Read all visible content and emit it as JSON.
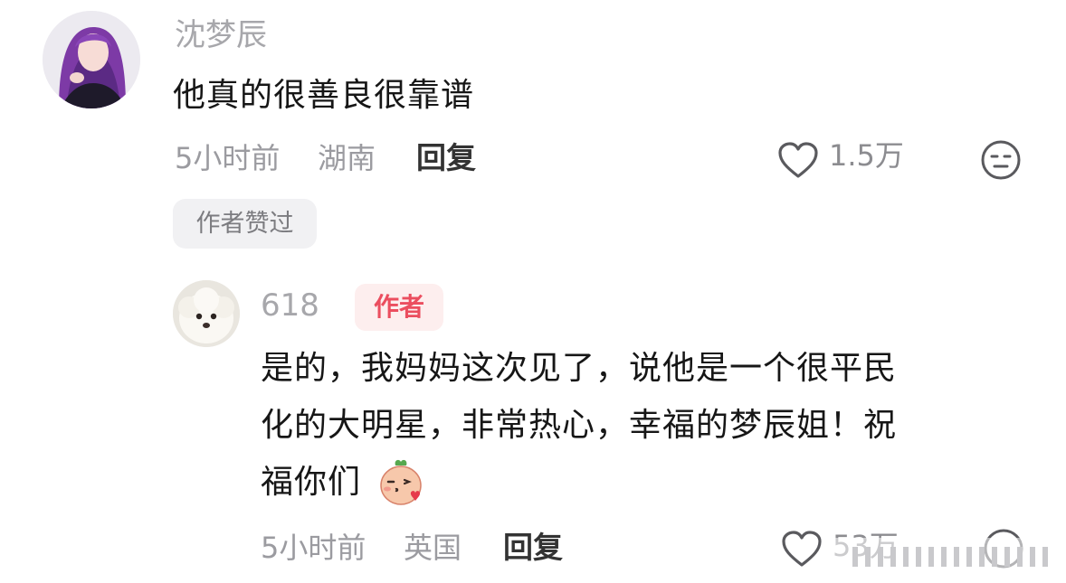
{
  "comment": {
    "username": "沈梦辰",
    "text": "他真的很善良很靠谱",
    "time": "5小时前",
    "location": "湖南",
    "reply_label": "回复",
    "like_count": "1.5万",
    "author_liked_badge": "作者赞过"
  },
  "reply": {
    "username": "618",
    "author_badge": "作者",
    "text_lines": [
      "是的，我妈妈这次见了，说他是一个很平民",
      "化的大明星，非常热心，幸福的梦辰姐！祝",
      "福你们"
    ],
    "time": "5小时前",
    "location": "英国",
    "reply_label": "回复",
    "like_count": "53万"
  },
  "icons": {
    "like": "heart-outline-icon",
    "dislike": "neutral-face-icon",
    "emoji": "kiss-emoji-icon"
  }
}
